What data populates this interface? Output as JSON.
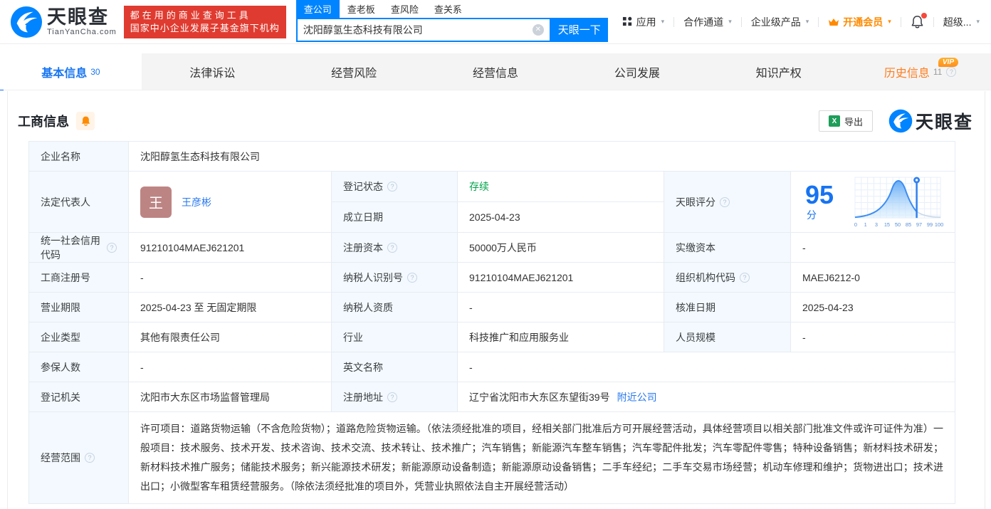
{
  "brand": {
    "logo_text": "天眼查",
    "logo_domain": "TianYanCha.com",
    "slogan_line1": "都在用的商业查询工具",
    "slogan_line2": "国家中小企业发展子基金旗下机构"
  },
  "search": {
    "tabs": [
      {
        "label": "查公司"
      },
      {
        "label": "查老板"
      },
      {
        "label": "查风险"
      },
      {
        "label": "查关系"
      }
    ],
    "value": "沈阳醇氢生态科技有限公司",
    "button": "天眼一下"
  },
  "top_nav": {
    "app": "应用",
    "partner": "合作通道",
    "enterprise": "企业级产品",
    "vip": "开通会员",
    "super": "超级..."
  },
  "tabs": [
    {
      "label": "基本信息",
      "count": "30"
    },
    {
      "label": "法律诉讼"
    },
    {
      "label": "经营风险"
    },
    {
      "label": "经营信息"
    },
    {
      "label": "公司发展"
    },
    {
      "label": "知识产权"
    },
    {
      "label": "历史信息",
      "count": "11",
      "vip": "VIP"
    }
  ],
  "section": {
    "title": "工商信息",
    "export_label": "导出",
    "watermark": "天眼查"
  },
  "table": {
    "company_name": {
      "label": "企业名称",
      "value": "沈阳醇氢生态科技有限公司"
    },
    "legal_rep": {
      "label": "法定代表人",
      "avatar": "王",
      "name": "王彦彬"
    },
    "reg_status": {
      "label": "登记状态",
      "value": "存续"
    },
    "establish_date": {
      "label": "成立日期",
      "value": "2025-04-23"
    },
    "score": {
      "label": "天眼评分",
      "value": "95",
      "unit": "分"
    },
    "credit_code": {
      "label": "统一社会信用代码",
      "value": "91210104MAEJ621201"
    },
    "reg_capital": {
      "label": "注册资本",
      "value": "50000万人民币"
    },
    "paid_capital": {
      "label": "实缴资本",
      "value": "-"
    },
    "reg_number": {
      "label": "工商注册号",
      "value": "-"
    },
    "taxpayer_id": {
      "label": "纳税人识别号",
      "value": "91210104MAEJ621201"
    },
    "org_code": {
      "label": "组织机构代码",
      "value": "MAEJ6212-0"
    },
    "business_term": {
      "label": "营业期限",
      "value": "2025-04-23 至 无固定期限"
    },
    "taxpayer_quality": {
      "label": "纳税人资质",
      "value": "-"
    },
    "approval_date": {
      "label": "核准日期",
      "value": "2025-04-23"
    },
    "company_type": {
      "label": "企业类型",
      "value": "其他有限责任公司"
    },
    "industry": {
      "label": "行业",
      "value": "科技推广和应用服务业"
    },
    "staff_size": {
      "label": "人员规模",
      "value": "-"
    },
    "insured_count": {
      "label": "参保人数",
      "value": "-"
    },
    "english_name": {
      "label": "英文名称",
      "value": "-"
    },
    "reg_authority": {
      "label": "登记机关",
      "value": "沈阳市大东区市场监督管理局"
    },
    "reg_address": {
      "label": "注册地址",
      "value": "辽宁省沈阳市大东区东望街39号",
      "link": "附近公司"
    },
    "business_scope": {
      "label": "经营范围",
      "value": "许可项目：道路货物运输（不含危险货物）；道路危险货物运输。（依法须经批准的项目，经相关部门批准后方可开展经营活动，具体经营项目以相关部门批准文件或许可证件为准）一般项目：技术服务、技术开发、技术咨询、技术交流、技术转让、技术推广；汽车销售；新能源汽车整车销售；汽车零配件批发；汽车零配件零售；特种设备销售；新材料技术研发；新材料技术推广服务；储能技术服务；新兴能源技术研发；新能源原动设备制造；新能源原动设备销售；二手车经纪；二手车交易市场经营；机动车修理和维护；货物进出口；技术进出口；小微型客车租赁经营服务。（除依法须经批准的项目外，凭营业执照依法自主开展经营活动）"
    }
  },
  "chart_data": {
    "type": "area",
    "title": "天眼评分分布曲线",
    "score": 95,
    "x_ticks": [
      "0",
      "1",
      "3",
      "15",
      "50",
      "85",
      "97",
      "99",
      "100"
    ],
    "marker_position": 95,
    "curve_shape": "bell curve peaking at tick 50, marker pin between ticks 85 and 97",
    "accent_color": "#2f80ef"
  },
  "icons": {
    "caret": "▾",
    "help": "?",
    "clear": "✕",
    "excel": "X"
  },
  "colors": {
    "brand_blue": "#0084ff",
    "link_blue": "#2878f0",
    "status_green": "#00a24a",
    "history_orange": "#ff7d1e",
    "member_orange": "#ff8a00",
    "banner_red": "#e03b30",
    "label_bg": "#f3f9fe",
    "border": "#e7ecf3"
  }
}
